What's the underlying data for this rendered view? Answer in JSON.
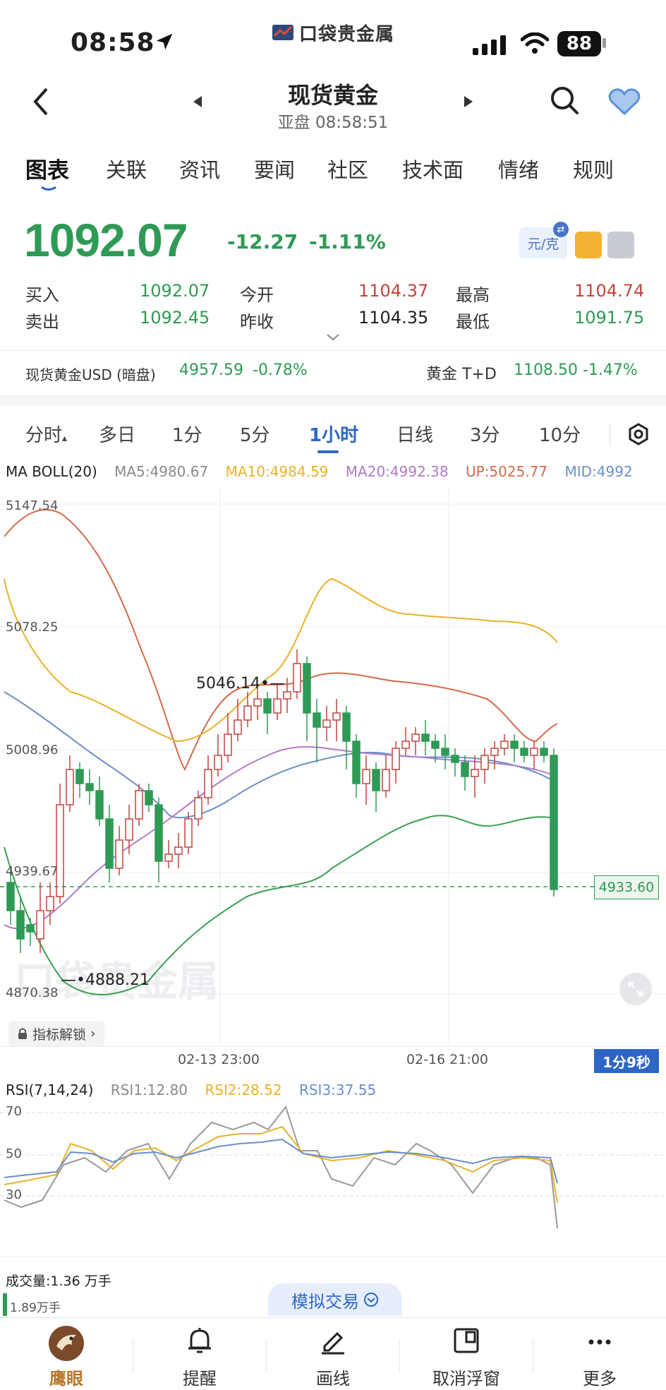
{
  "status": {
    "time": "08:58",
    "battery": "88"
  },
  "app": {
    "logo_text": "口袋贵金属"
  },
  "header": {
    "title": "现货黄金",
    "subtitle": "亚盘 08:58:51"
  },
  "tabs": [
    "图表",
    "关联",
    "资讯",
    "要闻",
    "社区",
    "技术面",
    "情绪",
    "规则"
  ],
  "quote": {
    "price": "1092.07",
    "change": "-12.27",
    "change_pct": "-1.11%",
    "unit": "元/克",
    "buy_label": "买入",
    "buy": "1092.07",
    "sell_label": "卖出",
    "sell": "1092.45",
    "open_label": "今开",
    "open": "1104.37",
    "prev_label": "昨收",
    "prev": "1104.35",
    "high_label": "最高",
    "high": "1104.74",
    "low_label": "最低",
    "low": "1091.75"
  },
  "tickers": {
    "left_name": "现货黄金USD (暗盘)",
    "left_price": "4957.59",
    "left_pct": "-0.78%",
    "right_name": "黄金 T+D",
    "right_price": "1108.50",
    "right_pct": "-1.47%"
  },
  "periods": [
    "分时",
    "多日",
    "1分",
    "5分",
    "1小时",
    "日线",
    "3分",
    "10分"
  ],
  "indicators": {
    "name": "MA BOLL(20)",
    "ma5": "MA5:4980.67",
    "ma10": "MA10:4984.59",
    "ma20": "MA20:4992.38",
    "up": "UP:5025.77",
    "mid": "MID:4992"
  },
  "colors": {
    "up": "#c0443e",
    "down": "#2f9a55",
    "ma5": "#8a8a8a",
    "ma10": "#e8b229",
    "ma20": "#b07ac8",
    "boll_up": "#d46a4a",
    "boll_mid": "#6a8fc8",
    "boll_low": "#3aa04e",
    "accent": "#2e66c4"
  },
  "chart": {
    "y_labels": [
      "5147.54",
      "5078.25",
      "5008.96",
      "4939.67",
      "4870.38"
    ],
    "high_mark": "5046.14",
    "low_mark": "4888.21",
    "last_price": "4933.60",
    "x_labels": [
      "02-13 23:00",
      "02-16 21:00"
    ],
    "lock_label": "指标解锁",
    "countdown": "1分9秒"
  },
  "rsi": {
    "name": "RSI(7,14,24)",
    "rsi1": "RSI1:12.80",
    "rsi2": "RSI2:28.52",
    "rsi3": "RSI3:37.55",
    "levels": [
      "70",
      "50",
      "30"
    ]
  },
  "volume": {
    "label": "成交量:1.36 万手",
    "sub": "1.89万手"
  },
  "sim_trade": "模拟交易",
  "bottom_nav": [
    "鹰眼",
    "提醒",
    "画线",
    "取消浮窗",
    "更多"
  ]
}
